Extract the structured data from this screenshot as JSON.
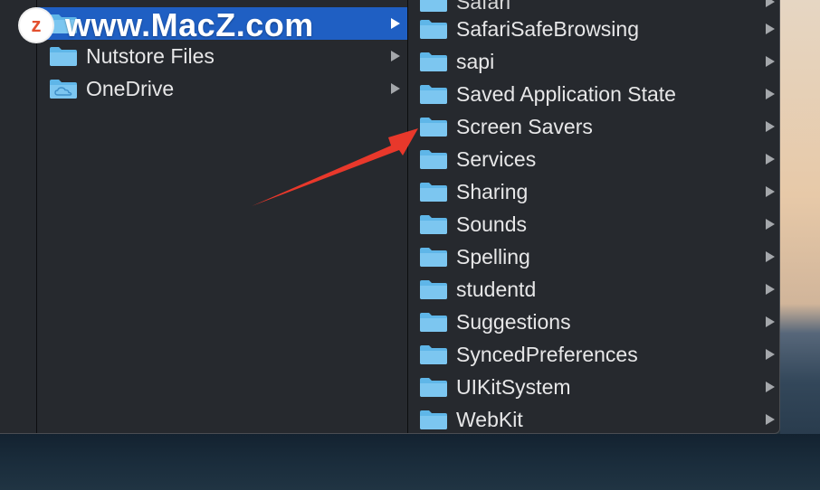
{
  "watermark": {
    "logo_letter": "z",
    "text": "www.MacZ.com"
  },
  "left_column": {
    "items": [
      {
        "label": "",
        "icon": "folder-icon",
        "selected": true,
        "has_children": true
      },
      {
        "label": "Nutstore Files",
        "icon": "folder-icon",
        "selected": false,
        "has_children": true
      },
      {
        "label": "OneDrive",
        "icon": "cloud-folder-icon",
        "selected": false,
        "has_children": true
      }
    ]
  },
  "right_column": {
    "partial_top_label": "Safari",
    "items": [
      {
        "label": "SafariSafeBrowsing",
        "icon": "folder-icon",
        "has_children": true
      },
      {
        "label": "sapi",
        "icon": "folder-icon",
        "has_children": true
      },
      {
        "label": "Saved Application State",
        "icon": "folder-icon",
        "has_children": true
      },
      {
        "label": "Screen Savers",
        "icon": "folder-icon",
        "has_children": true
      },
      {
        "label": "Services",
        "icon": "folder-icon",
        "has_children": true
      },
      {
        "label": "Sharing",
        "icon": "folder-icon",
        "has_children": true
      },
      {
        "label": "Sounds",
        "icon": "folder-icon",
        "has_children": true
      },
      {
        "label": "Spelling",
        "icon": "folder-icon",
        "has_children": true
      },
      {
        "label": "studentd",
        "icon": "folder-icon",
        "has_children": true
      },
      {
        "label": "Suggestions",
        "icon": "folder-icon",
        "has_children": true
      },
      {
        "label": "SyncedPreferences",
        "icon": "folder-icon",
        "has_children": true
      },
      {
        "label": "UIKitSystem",
        "icon": "folder-icon",
        "has_children": true
      },
      {
        "label": "WebKit",
        "icon": "folder-icon",
        "has_children": true
      }
    ]
  },
  "annotation": {
    "type": "red-arrow",
    "color": "#e8382b",
    "points_to": "Screen Savers"
  },
  "colors": {
    "selection": "#1f5fc3",
    "folder": "#5fb6e8",
    "window_bg": "#26292e",
    "text": "#e7e7e8"
  }
}
